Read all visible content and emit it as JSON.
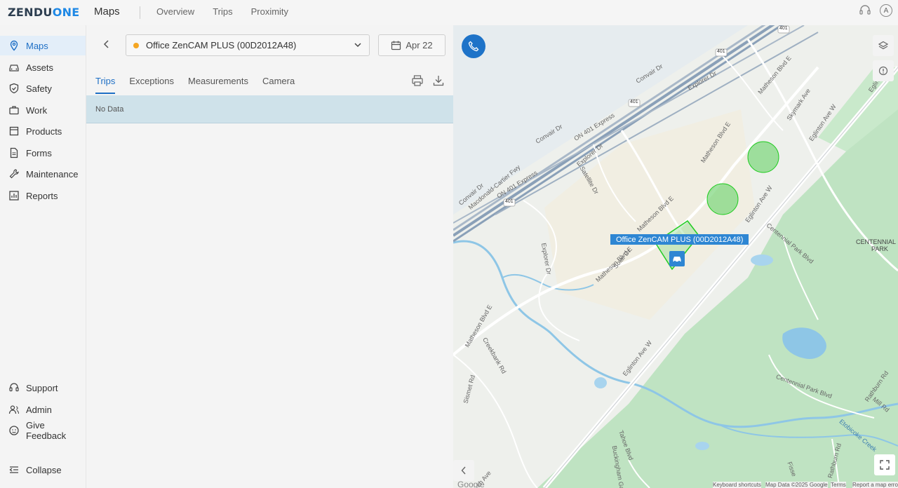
{
  "app": {
    "logo_text_1": "ZENDU",
    "logo_text_2": "ONE",
    "page_title": "Maps",
    "top_nav": [
      "Overview",
      "Trips",
      "Proximity"
    ],
    "avatar_initial": "A"
  },
  "sidebar": {
    "items": [
      {
        "label": "Maps",
        "icon": "map-pin-icon",
        "active": true
      },
      {
        "label": "Assets",
        "icon": "car-icon"
      },
      {
        "label": "Safety",
        "icon": "shield-icon"
      },
      {
        "label": "Work",
        "icon": "briefcase-icon"
      },
      {
        "label": "Products",
        "icon": "box-icon"
      },
      {
        "label": "Forms",
        "icon": "document-icon"
      },
      {
        "label": "Maintenance",
        "icon": "wrench-icon"
      },
      {
        "label": "Reports",
        "icon": "chart-icon"
      }
    ],
    "bottom_items": [
      {
        "label": "Support",
        "icon": "headset-icon"
      },
      {
        "label": "Admin",
        "icon": "users-icon"
      },
      {
        "label": "Give Feedback",
        "icon": "feedback-icon"
      },
      {
        "label": "Collapse",
        "icon": "collapse-icon"
      }
    ]
  },
  "panel": {
    "device_name": "Office ZenCAM PLUS (00D2012A48)",
    "device_status_color": "#f5a623",
    "date": "Apr 22",
    "tabs": [
      "Trips",
      "Exceptions",
      "Measurements",
      "Camera"
    ],
    "active_tab": "Trips",
    "empty_message": "No Data"
  },
  "map": {
    "vehicle_label": "Office ZenCAM PLUS (00D2012A48)",
    "labels": {
      "convair_dr_1": "Convair Dr",
      "convair_dr_2": "Convair Dr",
      "convair_dr_3": "Convair Dr",
      "explorer_dr_1": "Explorer Dr",
      "explorer_dr_2": "Explorer Dr",
      "explorer_dr_3": "Explorer Dr",
      "matheson_1": "Matheson Blvd E",
      "matheson_2": "Matheson Blvd E",
      "matheson_3": "Matheson Blvd E",
      "matheson_4": "Matheson Blvd E",
      "matheson_5": "Matheson Blvd E",
      "matheson_6": "Matheson Blvd E",
      "on401_1": "ON 401 Express",
      "on401_2": "ON 401 Express",
      "macdonald": "Macdonald-Cartier Fwy",
      "skymark": "Skymark Ave",
      "eglinton_1": "Eglinton Ave W",
      "eglinton_2": "Eglinton Ave W",
      "eglinton_3": "Eglinton Ave W",
      "eglinton_short": "Eglinto",
      "satellite": "Satellite Dr",
      "solar": "Solar Dr",
      "centennial_park_blvd_1": "Centennial Park Blvd",
      "centennial_park_blvd_2": "Centennial Park Blvd",
      "centennial_park_1": "CENTENNIAL",
      "centennial_park_2": "PARK",
      "creekbank": "Creekbank Rd",
      "sismet": "Sismet Rd",
      "tahoe": "Tahoe Blvd",
      "buckingham": "Buckingham Gate",
      "rathburn_1": "Rathburn Rd",
      "rathburn_2": "Rathburn Rd",
      "mill_rd": "Mill Rd",
      "etobicoke_creek": "Etobicoke Creek",
      "fisse": "Fisse",
      "ech_ave": "ch Ave",
      "hwy_401_a": "401",
      "hwy_401_b": "401",
      "hwy_401_c": "401",
      "hwy_401_d": "401"
    },
    "footer": {
      "google": "Google",
      "shortcuts": "Keyboard shortcuts",
      "map_data": "Map Data ©2025 Google",
      "terms": "Terms",
      "report": "Report a map error"
    },
    "colors": {
      "geofence_fill": "#7bd67b",
      "geofence_stroke": "#22cc22",
      "water": "#8ec6e6",
      "park": "#bfe3c2",
      "highway": "#8aa0b8"
    }
  }
}
